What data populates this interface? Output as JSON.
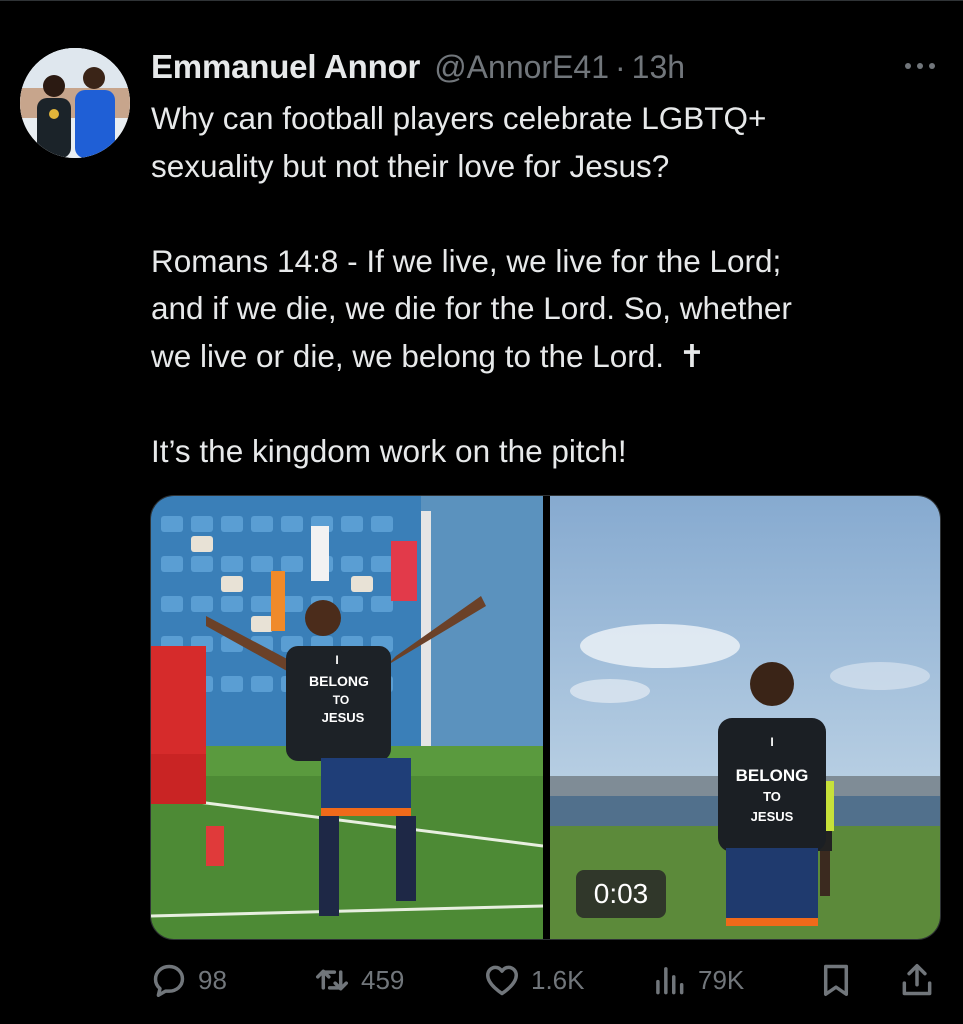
{
  "author": {
    "name": "Emmanuel Annor",
    "handle": "@AnnorE41",
    "separator": "·",
    "time": "13h"
  },
  "tweet": {
    "paragraphs": [
      [
        "Why can football players celebrate LGBTQ+",
        "sexuality but not their love for Jesus?"
      ],
      [
        "Romans 14:8 - If we live, we live for the Lord;",
        "and if we die, we die for the Lord. So, whether",
        "we live or die, we belong to the Lord."
      ],
      [
        "It’s the kingdom work on the pitch!"
      ]
    ],
    "emoji": "✝"
  },
  "media": {
    "left_shirt_text": [
      "I",
      "BELONG",
      "TO",
      "JESUS"
    ],
    "right_shirt_text": [
      "I",
      "BELONG",
      "TO",
      "JESUS"
    ],
    "video_duration": "0:03"
  },
  "actions": {
    "replies": "98",
    "reposts": "459",
    "likes": "1.6K",
    "views": "79K"
  },
  "colors": {
    "background": "#000000",
    "text": "#e7e9ea",
    "secondary": "#71767b"
  },
  "icons": [
    "more-icon",
    "reply-icon",
    "repost-icon",
    "like-icon",
    "views-icon",
    "bookmark-icon",
    "share-icon"
  ]
}
